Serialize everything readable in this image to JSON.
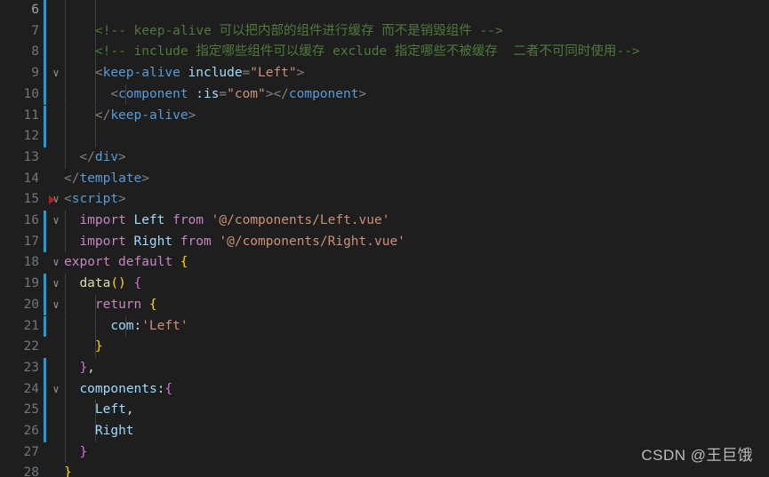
{
  "editor": {
    "theme_background": "#1e1e1e",
    "gutter_diff_color": "#1b9cd8",
    "breakpoint_color": "#b02020",
    "watermark": "CSDN @王巨饿",
    "first_visible_line": 6,
    "last_visible_line": 28
  },
  "lines": [
    {
      "number": "6",
      "active": true,
      "fold": "",
      "breakpoint": false,
      "diff": true,
      "indent_guides": 2,
      "text": ""
    },
    {
      "number": "7",
      "active": false,
      "fold": "",
      "breakpoint": false,
      "diff": true,
      "indent_guides": 2,
      "text": "    <!-- keep-alive 可以把内部的组件进行缓存 而不是销毁组件 -->"
    },
    {
      "number": "8",
      "active": false,
      "fold": "",
      "breakpoint": false,
      "diff": true,
      "indent_guides": 2,
      "text": "    <!-- include 指定哪些组件可以缓存 exclude 指定哪些不被缓存  二者不可同时使用-->"
    },
    {
      "number": "9",
      "active": false,
      "fold": "chevron-down",
      "breakpoint": false,
      "diff": true,
      "indent_guides": 2,
      "text": "    <keep-alive include=\"Left\">"
    },
    {
      "number": "10",
      "active": false,
      "fold": "",
      "breakpoint": false,
      "diff": true,
      "indent_guides": 3,
      "text": "      <component :is=\"com\"></component>"
    },
    {
      "number": "11",
      "active": false,
      "fold": "",
      "breakpoint": false,
      "diff": true,
      "indent_guides": 2,
      "text": "    </keep-alive>"
    },
    {
      "number": "12",
      "active": false,
      "fold": "",
      "breakpoint": false,
      "diff": true,
      "indent_guides": 2,
      "text": ""
    },
    {
      "number": "13",
      "active": false,
      "fold": "",
      "breakpoint": false,
      "diff": false,
      "indent_guides": 1,
      "text": "  </div>"
    },
    {
      "number": "14",
      "active": false,
      "fold": "",
      "breakpoint": false,
      "diff": false,
      "indent_guides": 0,
      "text": "</template>"
    },
    {
      "number": "15",
      "active": false,
      "fold": "chevron-down",
      "breakpoint": true,
      "diff": false,
      "indent_guides": 0,
      "text": "<script>"
    },
    {
      "number": "16",
      "active": false,
      "fold": "chevron-down",
      "breakpoint": false,
      "diff": true,
      "indent_guides": 1,
      "text": "  import Left from '@/components/Left.vue'"
    },
    {
      "number": "17",
      "active": false,
      "fold": "",
      "breakpoint": false,
      "diff": true,
      "indent_guides": 1,
      "text": "  import Right from '@/components/Right.vue'"
    },
    {
      "number": "18",
      "active": false,
      "fold": "chevron-down",
      "breakpoint": false,
      "diff": false,
      "indent_guides": 0,
      "text": "export default {"
    },
    {
      "number": "19",
      "active": false,
      "fold": "chevron-down",
      "breakpoint": false,
      "diff": true,
      "indent_guides": 1,
      "text": "  data() {"
    },
    {
      "number": "20",
      "active": false,
      "fold": "chevron-down",
      "breakpoint": false,
      "diff": true,
      "indent_guides": 2,
      "text": "    return {"
    },
    {
      "number": "21",
      "active": false,
      "fold": "",
      "breakpoint": false,
      "diff": true,
      "indent_guides": 3,
      "text": "      com:'Left'"
    },
    {
      "number": "22",
      "active": false,
      "fold": "",
      "breakpoint": false,
      "diff": false,
      "indent_guides": 2,
      "text": "    }"
    },
    {
      "number": "23",
      "active": false,
      "fold": "",
      "breakpoint": false,
      "diff": true,
      "indent_guides": 1,
      "text": "  },"
    },
    {
      "number": "24",
      "active": false,
      "fold": "chevron-down",
      "breakpoint": false,
      "diff": true,
      "indent_guides": 1,
      "text": "  components:{"
    },
    {
      "number": "25",
      "active": false,
      "fold": "",
      "breakpoint": false,
      "diff": true,
      "indent_guides": 2,
      "text": "    Left,"
    },
    {
      "number": "26",
      "active": false,
      "fold": "",
      "breakpoint": false,
      "diff": true,
      "indent_guides": 2,
      "text": "    Right"
    },
    {
      "number": "27",
      "active": false,
      "fold": "",
      "breakpoint": false,
      "diff": false,
      "indent_guides": 1,
      "text": "  }"
    },
    {
      "number": "28",
      "active": false,
      "fold": "",
      "breakpoint": false,
      "diff": false,
      "indent_guides": 0,
      "text": "}"
    }
  ],
  "tokens": {
    "6": [],
    "7": [
      {
        "t": "    ",
        "c": "plain"
      },
      {
        "t": "<!-- keep-alive 可以把内部的组件进行缓存 而不是销毁组件 -->",
        "c": "cmt"
      }
    ],
    "8": [
      {
        "t": "    ",
        "c": "plain"
      },
      {
        "t": "<!-- include 指定哪些组件可以缓存 exclude 指定哪些不被缓存  二者不可同时使用-->",
        "c": "cmt"
      }
    ],
    "9": [
      {
        "t": "    ",
        "c": "plain"
      },
      {
        "t": "<",
        "c": "punc"
      },
      {
        "t": "keep-alive",
        "c": "tag"
      },
      {
        "t": " ",
        "c": "plain"
      },
      {
        "t": "include",
        "c": "attr"
      },
      {
        "t": "=",
        "c": "punc"
      },
      {
        "t": "\"Left\"",
        "c": "str"
      },
      {
        "t": ">",
        "c": "punc"
      }
    ],
    "10": [
      {
        "t": "      ",
        "c": "plain"
      },
      {
        "t": "<",
        "c": "punc"
      },
      {
        "t": "component",
        "c": "tag"
      },
      {
        "t": " ",
        "c": "plain"
      },
      {
        "t": ":is",
        "c": "attr"
      },
      {
        "t": "=",
        "c": "punc"
      },
      {
        "t": "\"com\"",
        "c": "str"
      },
      {
        "t": ">",
        "c": "punc"
      },
      {
        "t": "</",
        "c": "punc"
      },
      {
        "t": "component",
        "c": "tag"
      },
      {
        "t": ">",
        "c": "punc"
      }
    ],
    "11": [
      {
        "t": "    ",
        "c": "plain"
      },
      {
        "t": "</",
        "c": "punc"
      },
      {
        "t": "keep-alive",
        "c": "tag"
      },
      {
        "t": ">",
        "c": "punc"
      }
    ],
    "12": [],
    "13": [
      {
        "t": "  ",
        "c": "plain"
      },
      {
        "t": "</",
        "c": "punc"
      },
      {
        "t": "div",
        "c": "tag"
      },
      {
        "t": ">",
        "c": "punc"
      }
    ],
    "14": [
      {
        "t": "</",
        "c": "punc"
      },
      {
        "t": "template",
        "c": "tag"
      },
      {
        "t": ">",
        "c": "punc"
      }
    ],
    "15": [
      {
        "t": "<",
        "c": "punc"
      },
      {
        "t": "script",
        "c": "tag"
      },
      {
        "t": ">",
        "c": "punc"
      }
    ],
    "16": [
      {
        "t": "  ",
        "c": "plain"
      },
      {
        "t": "import",
        "c": "kw"
      },
      {
        "t": " ",
        "c": "plain"
      },
      {
        "t": "Left",
        "c": "attr"
      },
      {
        "t": " ",
        "c": "plain"
      },
      {
        "t": "from",
        "c": "kw"
      },
      {
        "t": " ",
        "c": "plain"
      },
      {
        "t": "'@/components/Left.vue'",
        "c": "str"
      }
    ],
    "17": [
      {
        "t": "  ",
        "c": "plain"
      },
      {
        "t": "import",
        "c": "kw"
      },
      {
        "t": " ",
        "c": "plain"
      },
      {
        "t": "Right",
        "c": "attr"
      },
      {
        "t": " ",
        "c": "plain"
      },
      {
        "t": "from",
        "c": "kw"
      },
      {
        "t": " ",
        "c": "plain"
      },
      {
        "t": "'@/components/Right.vue'",
        "c": "str"
      }
    ],
    "18": [
      {
        "t": "export",
        "c": "kw"
      },
      {
        "t": " ",
        "c": "plain"
      },
      {
        "t": "default",
        "c": "kw"
      },
      {
        "t": " ",
        "c": "plain"
      },
      {
        "t": "{",
        "c": "br1"
      }
    ],
    "19": [
      {
        "t": "  ",
        "c": "plain"
      },
      {
        "t": "data",
        "c": "fn"
      },
      {
        "t": "(",
        "c": "br1"
      },
      {
        "t": ")",
        "c": "br1"
      },
      {
        "t": " ",
        "c": "plain"
      },
      {
        "t": "{",
        "c": "br2"
      }
    ],
    "20": [
      {
        "t": "    ",
        "c": "plain"
      },
      {
        "t": "return",
        "c": "kw"
      },
      {
        "t": " ",
        "c": "plain"
      },
      {
        "t": "{",
        "c": "br1"
      }
    ],
    "21": [
      {
        "t": "      ",
        "c": "plain"
      },
      {
        "t": "com",
        "c": "attr"
      },
      {
        "t": ":",
        "c": "plain"
      },
      {
        "t": "'Left'",
        "c": "str"
      }
    ],
    "22": [
      {
        "t": "    ",
        "c": "plain"
      },
      {
        "t": "}",
        "c": "br1"
      }
    ],
    "23": [
      {
        "t": "  ",
        "c": "plain"
      },
      {
        "t": "}",
        "c": "br2"
      },
      {
        "t": ",",
        "c": "plain"
      }
    ],
    "24": [
      {
        "t": "  ",
        "c": "plain"
      },
      {
        "t": "components",
        "c": "attr"
      },
      {
        "t": ":",
        "c": "plain"
      },
      {
        "t": "{",
        "c": "br2"
      }
    ],
    "25": [
      {
        "t": "    ",
        "c": "plain"
      },
      {
        "t": "Left",
        "c": "attr"
      },
      {
        "t": ",",
        "c": "plain"
      }
    ],
    "26": [
      {
        "t": "    ",
        "c": "plain"
      },
      {
        "t": "Right",
        "c": "attr"
      }
    ],
    "27": [
      {
        "t": "  ",
        "c": "plain"
      },
      {
        "t": "}",
        "c": "br2"
      }
    ],
    "28": [
      {
        "t": "}",
        "c": "br1"
      }
    ]
  }
}
